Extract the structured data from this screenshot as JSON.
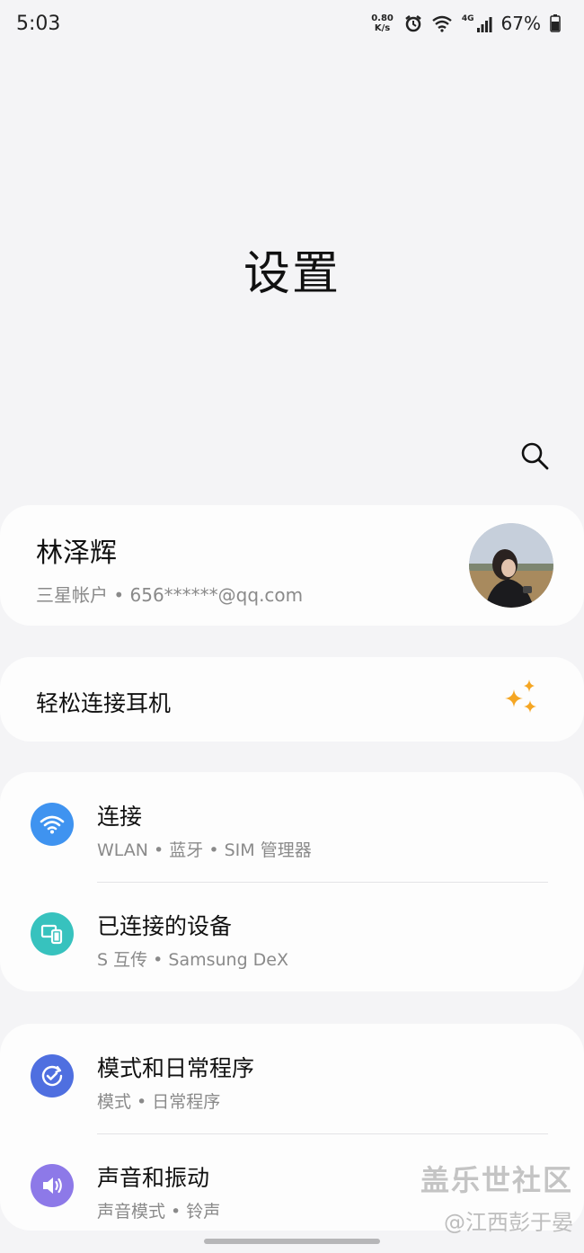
{
  "status_bar": {
    "time": "5:03",
    "net_speed_value": "0.80",
    "net_speed_unit": "K/s",
    "network_type": "4G",
    "battery": "67%"
  },
  "page": {
    "title": "设置"
  },
  "account": {
    "name": "林泽辉",
    "subtitle": "三星帐户 • 656******@qq.com"
  },
  "earbuds": {
    "label": "轻松连接耳机"
  },
  "groups": [
    {
      "items": [
        {
          "label": "连接",
          "sub": "WLAN • 蓝牙 • SIM 管理器",
          "icon": "wifi-icon",
          "color": "#3f93f0"
        },
        {
          "label": "已连接的设备",
          "sub": "S 互传 • Samsung DeX",
          "icon": "devices-icon",
          "color": "#37c2be"
        }
      ]
    },
    {
      "items": [
        {
          "label": "模式和日常程序",
          "sub": "模式 • 日常程序",
          "icon": "routine-check-icon",
          "color": "#4f6fe0"
        },
        {
          "label": "声音和振动",
          "sub": "声音模式 • 铃声",
          "icon": "speaker-icon",
          "color": "#8d79e8"
        }
      ]
    }
  ],
  "watermark": {
    "line1": "盖乐世社区",
    "line2": "@江西彭于晏"
  },
  "colors": {
    "background": "#f4f4f6",
    "card": "#fdfdfd",
    "sparkle": "#f5a623"
  }
}
